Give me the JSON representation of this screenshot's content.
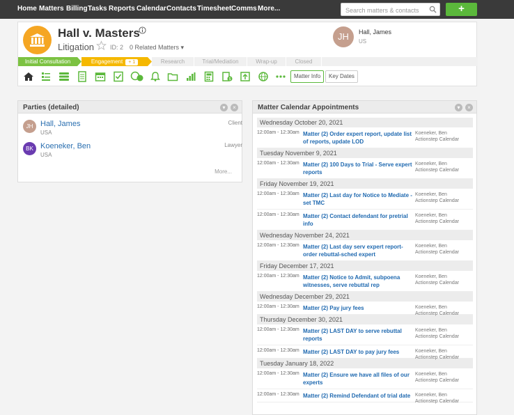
{
  "nav": {
    "items": [
      "Home",
      "Matters",
      "Billing",
      "Tasks",
      "Reports",
      "Calendar",
      "Contacts",
      "Timesheet",
      "Comms",
      "More..."
    ],
    "search_placeholder": "Search matters & contacts",
    "add_label": "+"
  },
  "matter": {
    "title": "Hall v. Masters",
    "type": "Litigation",
    "id_label": "ID: 2",
    "related": "0  Related Matters ▾",
    "person": {
      "initials": "JH",
      "name": "Hall, James",
      "location": "US"
    }
  },
  "stages": [
    {
      "label": "Initial Consultation",
      "state": "done"
    },
    {
      "label": "Engagement",
      "state": "current",
      "badge": "+ 1"
    },
    {
      "label": "Research",
      "state": "todo"
    },
    {
      "label": "Trial/Mediation",
      "state": "todo"
    },
    {
      "label": "Wrap-up",
      "state": "todo"
    },
    {
      "label": "Closed",
      "state": "todo"
    }
  ],
  "toolbar": {
    "icons": [
      "home-icon",
      "list-icon",
      "stack-icon",
      "document-icon",
      "calendar-icon",
      "checklist-icon",
      "comments-icon",
      "bell-icon",
      "folder-icon",
      "bar-chart-icon",
      "calculator-icon",
      "billing-icon",
      "export-icon",
      "globe-icon",
      "more-icon"
    ],
    "matter_info": "Matter Info",
    "key_dates": "Key Dates"
  },
  "parties": {
    "title": "Parties (detailed)",
    "items": [
      {
        "initials": "JH",
        "name": "Hall, James",
        "location": "USA",
        "role": "Client",
        "color": "#c59f8e"
      },
      {
        "initials": "BK",
        "name": "Koeneker, Ben",
        "location": "USA",
        "role": "Lawyer",
        "color": "#6a3bb0"
      }
    ],
    "more": "More..."
  },
  "calendar": {
    "title": "Matter Calendar Appointments",
    "groups": [
      {
        "date": "Wednesday October 20, 2021",
        "items": [
          {
            "time": "12:00am - 12:30am",
            "title": "Matter (2) Order expert report, update list of reports, update LOD",
            "owner": "Koeneker, Ben",
            "cal": "Actionstep Calendar"
          }
        ]
      },
      {
        "date": "Tuesday November 9, 2021",
        "items": [
          {
            "time": "12:00am - 12:30am",
            "title": "Matter (2) 100 Days to Trial - Serve expert reports",
            "owner": "Koeneker, Ben",
            "cal": "Actionstep Calendar"
          }
        ]
      },
      {
        "date": "Friday November 19, 2021",
        "items": [
          {
            "time": "12:00am - 12:30am",
            "title": "Matter (2) Last day for Notice to Mediate - set TMC",
            "owner": "Koeneker, Ben",
            "cal": "Actionstep Calendar"
          },
          {
            "time": "12:00am - 12:30am",
            "title": "Matter (2) Contact defendant for pretrial info",
            "owner": "Koeneker, Ben",
            "cal": "Actionstep Calendar"
          }
        ]
      },
      {
        "date": "Wednesday November 24, 2021",
        "items": [
          {
            "time": "12:00am - 12:30am",
            "title": "Matter (2) Last day serv expert report-order rebuttal-sched expert",
            "owner": "Koeneker, Ben",
            "cal": "Actionstep Calendar"
          }
        ]
      },
      {
        "date": "Friday December 17, 2021",
        "items": [
          {
            "time": "12:00am - 12:30am",
            "title": "Matter (2) Notice to Admit, subpoena witnesses, serve rebuttal rep",
            "owner": "Koeneker, Ben",
            "cal": "Actionstep Calendar"
          }
        ]
      },
      {
        "date": "Wednesday December 29, 2021",
        "items": [
          {
            "time": "12:00am - 12:30am",
            "title": "Matter (2) Pay jury fees",
            "owner": "Koeneker, Ben",
            "cal": "Actionstep Calendar"
          }
        ]
      },
      {
        "date": "Thursday December 30, 2021",
        "items": [
          {
            "time": "12:00am - 12:30am",
            "title": "Matter (2) LAST DAY to serve rebuttal reports",
            "owner": "Koeneker, Ben",
            "cal": "Actionstep Calendar"
          },
          {
            "time": "12:00am - 12:30am",
            "title": "Matter (2) LAST DAY to pay jury fees",
            "owner": "Koeneker, Ben",
            "cal": "Actionstep Calendar"
          }
        ]
      },
      {
        "date": "Tuesday January 18, 2022",
        "items": [
          {
            "time": "12:00am - 12:30am",
            "title": "Matter (2) Ensure we have all files of our experts",
            "owner": "Koeneker, Ben",
            "cal": "Actionstep Calendar"
          },
          {
            "time": "12:00am - 12:30am",
            "title": "Matter (2) Remind Defendant of trial date",
            "owner": "Koeneker, Ben",
            "cal": "Actionstep Calendar"
          }
        ]
      }
    ]
  },
  "colors": {
    "nav_bg": "#3a3a3a",
    "accent_green": "#5bb83b",
    "stage_done": "#7cc242",
    "stage_current": "#f5b800",
    "matter_icon": "#f5a623",
    "link_blue": "#1f69b0"
  }
}
